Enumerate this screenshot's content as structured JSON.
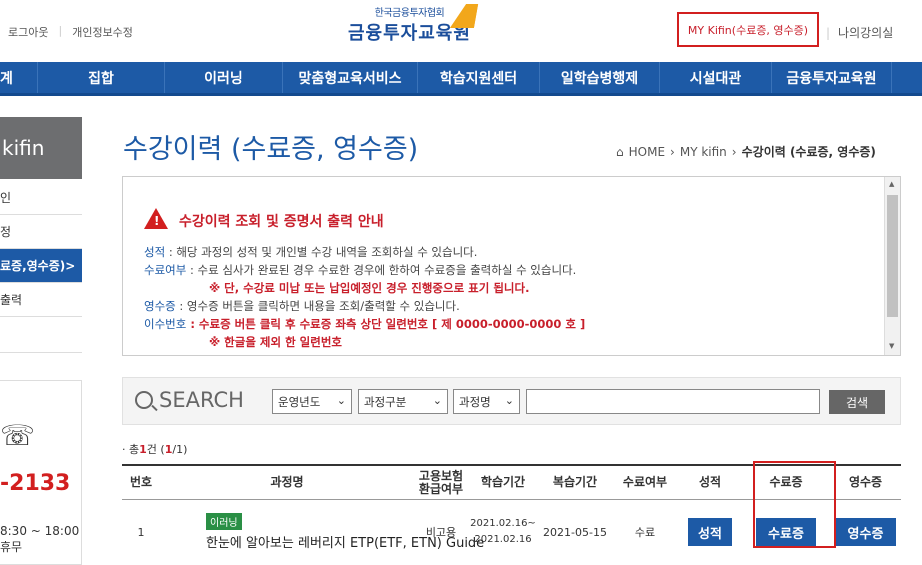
{
  "top": {
    "logout": "로그아웃",
    "edit_info": "개인정보수정",
    "logo_sub": "한국금융투자협회",
    "logo_main": "금융투자교육원",
    "mykifin_link": "MY Kifin(수료증, 영수증)",
    "my_courses": "나의강의실"
  },
  "nav": [
    "계",
    "집합",
    "이러닝",
    "맞춤형교육서비스",
    "학습지원센터",
    "일학습병행제",
    "시설대관",
    "금융투자교육원"
  ],
  "sidebar": {
    "head": "kifin",
    "items": [
      {
        "label": "인"
      },
      {
        "label": "정"
      },
      {
        "label": "료증,영수증)>"
      },
      {
        "label": "출력"
      },
      {
        "label": ""
      }
    ],
    "cs_phone": "-2133",
    "cs_hours": "8:30 ~ 18:00",
    "cs_holiday": "휴무"
  },
  "page": {
    "title": "수강이력 (수료증, 영수증)",
    "breadcrumb": [
      "HOME",
      "MY kifin",
      "수강이력 (수료증, 영수증)"
    ]
  },
  "notice": {
    "title": "수강이력 조회 및 증명서 출력 안내",
    "line1_key": "성적",
    "line1_text": " : 해당 과정의 성적 및 개인별 수강 내역을 조회하실 수 있습니다.",
    "line2_key": "수료여부",
    "line2_text": " : 수료 심사가 완료된 경우 수료한 경우에 한하여 수료증을 출력하실 수 있습니다.",
    "line3": "※ 단, 수강료 미납 또는 납입예정인 경우 진행중으로 표기 됩니다.",
    "line4_key": "영수증",
    "line4_text": " : 영수증 버튼을 클릭하면 내용을 조회/출력할 수 있습니다.",
    "line5_key": "이수번호",
    "line5_text": " : 수료증 버튼 클릭 후 수료증 좌측 상단 일련번호 [ 제 0000-0000-0000 호 ]",
    "line6": "※ 한글을 제외 한 일련번호"
  },
  "search": {
    "label": "SEARCH",
    "year": "운영년도",
    "type": "과정구분",
    "name": "과정명",
    "button": "검색"
  },
  "count": {
    "prefix": "총",
    "num": "1",
    "mid": "건 (",
    "page": "1",
    "suffix": "/1)"
  },
  "table": {
    "headers": [
      "번호",
      "과정명",
      "고용보험\n환급여부",
      "학습기간",
      "복습기간",
      "수료여부",
      "성적",
      "수료증",
      "영수증"
    ],
    "rows": [
      {
        "no": "1",
        "badge": "이러닝",
        "course": "한눈에 알아보는 레버리지 ETP(ETF, ETN) Guide",
        "insurance": "비고용",
        "period_start": "2021.02.16~",
        "period_end": "2021.02.16",
        "review": "2021-05-15",
        "status": "수료",
        "grade_btn": "성적",
        "cert_btn": "수료증",
        "receipt_btn": "영수증"
      }
    ]
  }
}
